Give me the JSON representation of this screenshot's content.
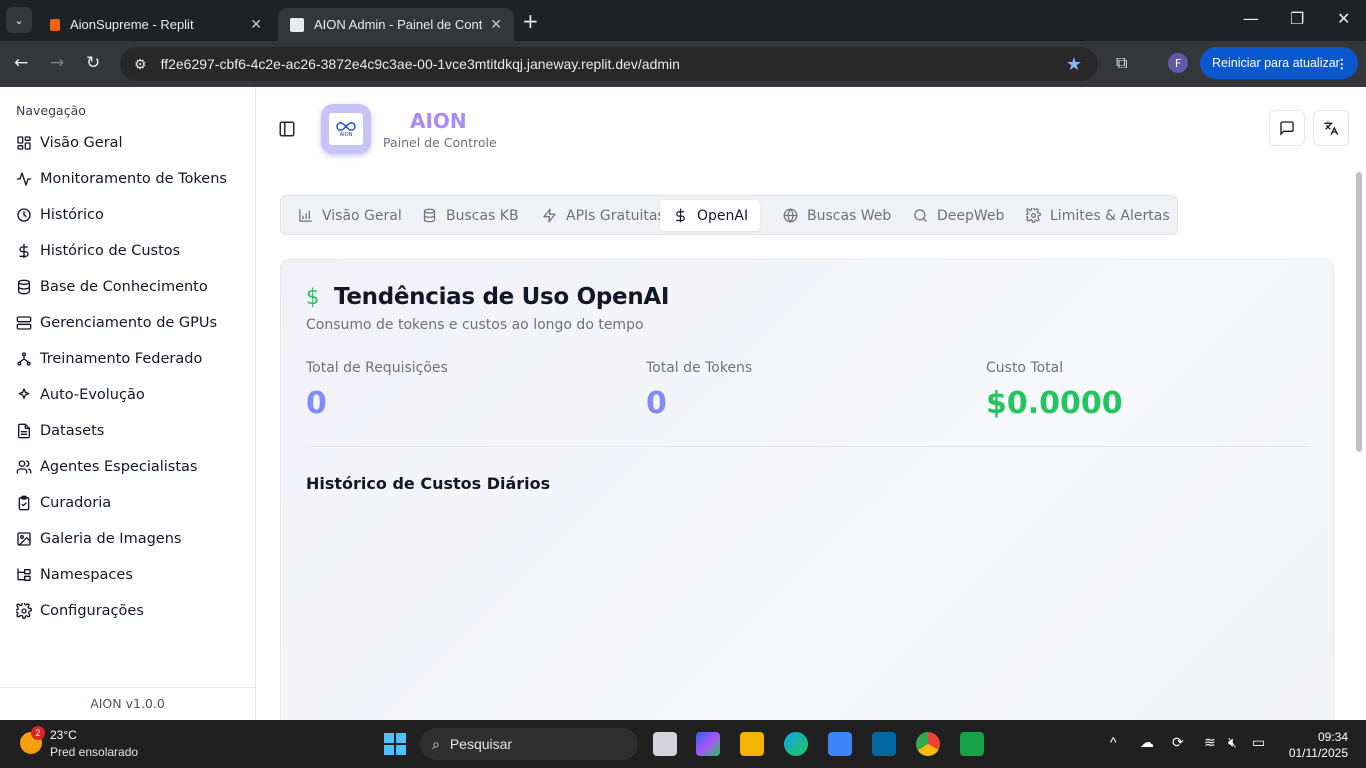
{
  "browser": {
    "tabs": [
      {
        "title": "AionSupreme - Replit",
        "active": false
      },
      {
        "title": "AION Admin - Painel de Controle",
        "active": true
      }
    ],
    "url": "ff2e6297-cbf6-4c2e-ac26-3872e4c9c3ae-00-1vce3mtitdkqj.janeway.replit.dev/admin",
    "profile_initial": "F",
    "update_button": "Reiniciar para atualizar"
  },
  "sidebar": {
    "section_label": "Navegação",
    "items": [
      {
        "label": "Visão Geral",
        "icon": "layout-grid-icon"
      },
      {
        "label": "Monitoramento de Tokens",
        "icon": "activity-icon"
      },
      {
        "label": "Histórico",
        "icon": "clock-icon"
      },
      {
        "label": "Histórico de Custos",
        "icon": "dollar-icon"
      },
      {
        "label": "Base de Conhecimento",
        "icon": "database-icon"
      },
      {
        "label": "Gerenciamento de GPUs",
        "icon": "server-icon"
      },
      {
        "label": "Treinamento Federado",
        "icon": "network-icon"
      },
      {
        "label": "Auto-Evolução",
        "icon": "sparkles-icon"
      },
      {
        "label": "Datasets",
        "icon": "file-text-icon"
      },
      {
        "label": "Agentes Especialistas",
        "icon": "users-icon"
      },
      {
        "label": "Curadoria",
        "icon": "clipboard-check-icon"
      },
      {
        "label": "Galeria de Imagens",
        "icon": "images-icon"
      },
      {
        "label": "Namespaces",
        "icon": "folder-tree-icon"
      },
      {
        "label": "Configurações",
        "icon": "settings-icon"
      }
    ],
    "footer": "AION v1.0.0"
  },
  "header": {
    "brand": "AION",
    "subtitle": "Painel de Controle",
    "logo_text": "AION"
  },
  "tabs": [
    {
      "label": "Visão Geral",
      "icon": "bar-chart-icon",
      "active": false
    },
    {
      "label": "Buscas KB",
      "icon": "database-icon",
      "active": false
    },
    {
      "label": "APIs Gratuitas",
      "icon": "zap-icon",
      "active": false
    },
    {
      "label": "OpenAI",
      "icon": "dollar-icon",
      "active": true
    },
    {
      "label": "Buscas Web",
      "icon": "globe-icon",
      "active": false
    },
    {
      "label": "DeepWeb",
      "icon": "search-icon",
      "active": false
    },
    {
      "label": "Limites & Alertas",
      "icon": "settings-icon",
      "active": false
    }
  ],
  "card": {
    "icon": "$",
    "title": "Tendências de Uso OpenAI",
    "subtitle": "Consumo de tokens e custos ao longo do tempo",
    "stats": [
      {
        "label": "Total de Requisições",
        "value": "0",
        "color": "#818cf8"
      },
      {
        "label": "Total de Tokens",
        "value": "0",
        "color": "#818cf8"
      },
      {
        "label": "Custo Total",
        "value": "$0.0000",
        "color": "#22c55e"
      }
    ],
    "chart_title": "Histórico de Custos Diários"
  },
  "taskbar": {
    "weather_temp": "23°C",
    "weather_desc": "Pred ensolarado",
    "weather_badge": "2",
    "search_placeholder": "Pesquisar",
    "time": "09:34",
    "date": "01/11/2025"
  }
}
